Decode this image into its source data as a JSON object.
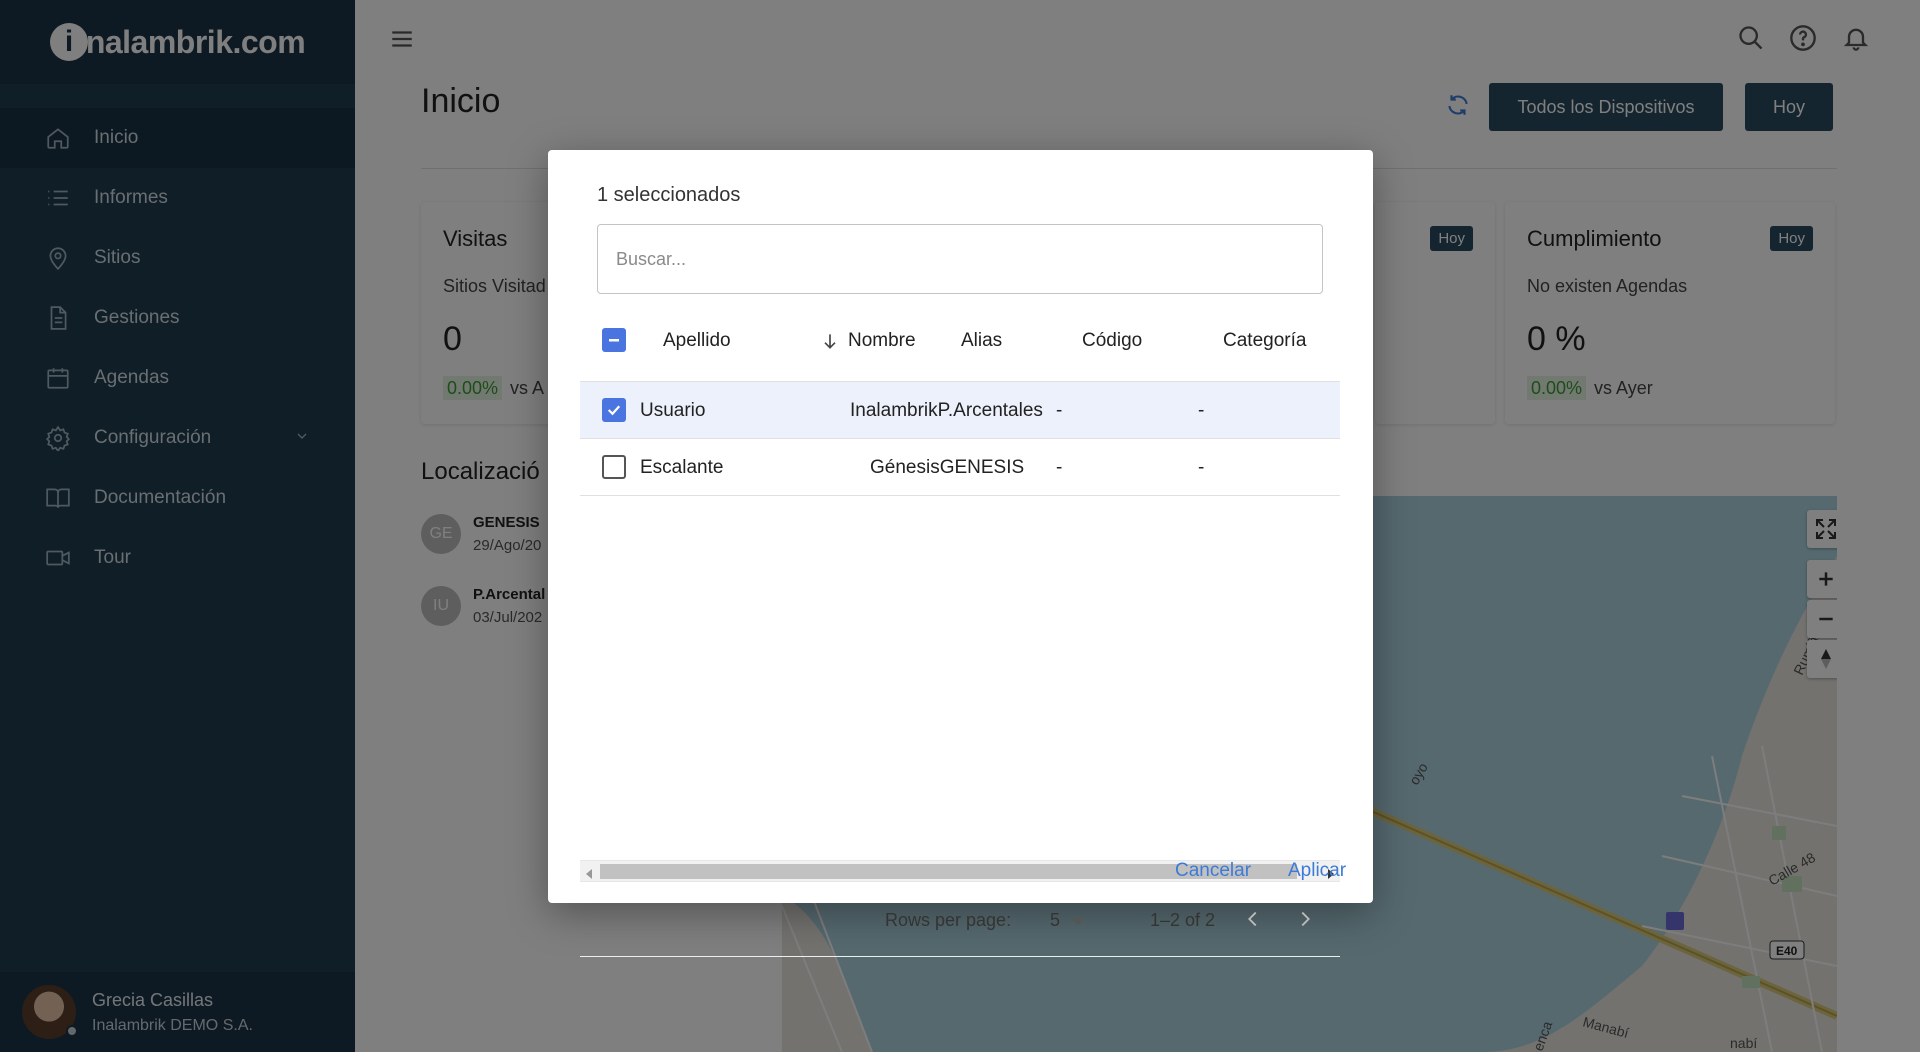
{
  "brand": {
    "logo_letter": "i",
    "name": "nalambrik.com"
  },
  "sidebar": {
    "items": [
      {
        "label": "Inicio",
        "icon": "home-icon"
      },
      {
        "label": "Informes",
        "icon": "list-icon"
      },
      {
        "label": "Sitios",
        "icon": "location-pin-icon"
      },
      {
        "label": "Gestiones",
        "icon": "document-icon"
      },
      {
        "label": "Agendas",
        "icon": "calendar-icon"
      },
      {
        "label": "Configuración",
        "icon": "gear-icon"
      },
      {
        "label": "Documentación",
        "icon": "book-icon"
      },
      {
        "label": "Tour",
        "icon": "video-icon"
      }
    ],
    "user": {
      "name": "Grecia Casillas",
      "org": "Inalambrik DEMO S.A."
    }
  },
  "header": {
    "title": "Inicio",
    "devices_button": "Todos los Dispositivos",
    "today_button": "Hoy"
  },
  "cards": {
    "visitas": {
      "title": "Visitas",
      "sub": "Sitios Visitad",
      "value": "0",
      "pct": "0.00%",
      "vs": "vs A"
    },
    "cumplimiento": {
      "title": "Cumplimiento",
      "badge": "Hoy",
      "sub": "No existen Agendas",
      "value": "0 %",
      "pct": "0.00%",
      "vs": "vs Ayer"
    },
    "hidden_badge": "Hoy"
  },
  "localizacion": {
    "title": "Localizació",
    "items": [
      {
        "initials": "GE",
        "name": "GENESIS",
        "date": "29/Ago/20"
      },
      {
        "initials": "IU",
        "name": "P.Arcental",
        "date": "03/Jul/202"
      }
    ]
  },
  "map": {
    "labels": [
      "Rumiñah",
      "Calle 48",
      "E40",
      "Manabí",
      "enca",
      "oyo",
      "nabí"
    ]
  },
  "dialog": {
    "selected_count": "1 seleccionados",
    "search_placeholder": "Buscar...",
    "columns": [
      "Apellido",
      "Nombre",
      "Alias",
      "Código",
      "Categoría"
    ],
    "rows": [
      {
        "apellido": "Usuario",
        "nombre": "InalambrikP.Arcentales",
        "alias": "-",
        "codigo": "-",
        "checked": true
      },
      {
        "apellido": "Escalante",
        "nombre": "GénesisGENESIS",
        "alias": "-",
        "codigo": "-",
        "checked": false
      }
    ],
    "rows_per_page_label": "Rows per page:",
    "rows_per_page_value": "5",
    "range": "1–2 of 2",
    "cancel": "Cancelar",
    "apply": "Aplicar"
  },
  "colors": {
    "sidebar": "#1e3c4f",
    "accent": "#2a4a5e",
    "link": "#3d7bd6",
    "checkbox": "#4a74e0"
  }
}
